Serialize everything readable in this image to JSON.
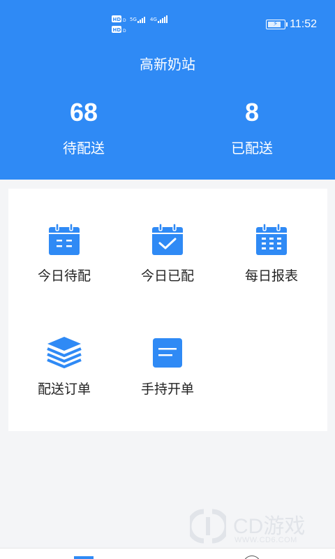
{
  "status_bar": {
    "time": "11:52",
    "network_tags": [
      "HD",
      "5G",
      "HD",
      "4G"
    ]
  },
  "header": {
    "title": "高新奶站",
    "stats": [
      {
        "value": "68",
        "label": "待配送"
      },
      {
        "value": "8",
        "label": "已配送"
      }
    ]
  },
  "menu": {
    "items": [
      {
        "label": "今日待配",
        "icon": "calendar-list-icon"
      },
      {
        "label": "今日已配",
        "icon": "calendar-check-icon"
      },
      {
        "label": "每日报表",
        "icon": "calendar-grid-icon"
      },
      {
        "label": "配送订单",
        "icon": "stack-layers-icon"
      },
      {
        "label": "手持开单",
        "icon": "note-icon"
      }
    ]
  },
  "watermark": {
    "brand": "CD游戏",
    "url": "WWW.CD6.COM"
  },
  "colors": {
    "primary": "#2f8af5",
    "background": "#f4f5f7",
    "card": "#ffffff"
  }
}
